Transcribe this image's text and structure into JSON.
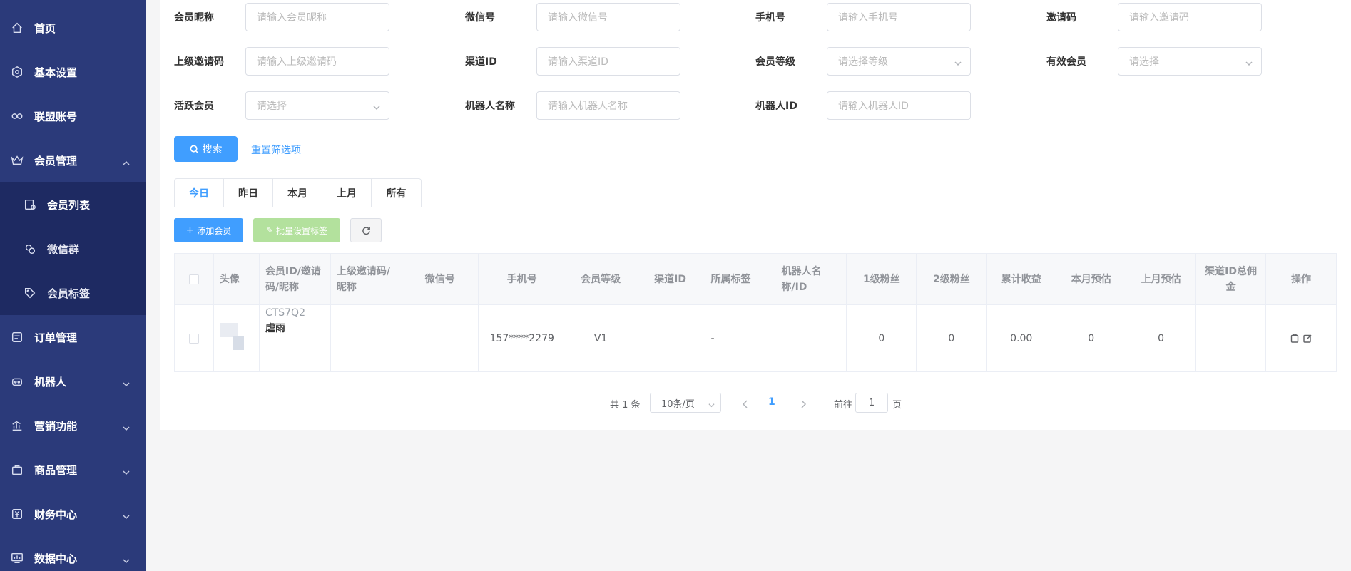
{
  "sidebar": {
    "items": [
      {
        "label": "首页",
        "icon": "home-icon"
      },
      {
        "label": "基本设置",
        "icon": "settings-icon"
      },
      {
        "label": "联盟账号",
        "icon": "link-icon"
      },
      {
        "label": "会员管理",
        "icon": "crown-icon",
        "expanded": true
      },
      {
        "label": "订单管理",
        "icon": "order-icon"
      },
      {
        "label": "机器人",
        "icon": "robot-icon"
      },
      {
        "label": "营销功能",
        "icon": "chart-icon"
      },
      {
        "label": "商品管理",
        "icon": "goods-icon"
      },
      {
        "label": "财务中心",
        "icon": "finance-icon"
      },
      {
        "label": "数据中心",
        "icon": "monitor-icon"
      }
    ],
    "sub_items": [
      {
        "label": "会员列表",
        "icon": "member-list-icon",
        "active": true
      },
      {
        "label": "微信群",
        "icon": "wechat-group-icon"
      },
      {
        "label": "会员标签",
        "icon": "tag-icon"
      }
    ]
  },
  "filters": [
    {
      "label": "会员昵称",
      "placeholder": "请输入会员昵称",
      "type": "input"
    },
    {
      "label": "微信号",
      "placeholder": "请输入微信号",
      "type": "input"
    },
    {
      "label": "手机号",
      "placeholder": "请输入手机号",
      "type": "input"
    },
    {
      "label": "邀请码",
      "placeholder": "请输入邀请码",
      "type": "input"
    },
    {
      "label": "上级邀请码",
      "placeholder": "请输入上级邀请码",
      "type": "input"
    },
    {
      "label": "渠道ID",
      "placeholder": "请输入渠道ID",
      "type": "input"
    },
    {
      "label": "会员等级",
      "placeholder": "请选择等级",
      "type": "select"
    },
    {
      "label": "有效会员",
      "placeholder": "请选择",
      "type": "select"
    },
    {
      "label": "活跃会员",
      "placeholder": "请选择",
      "type": "select"
    },
    {
      "label": "机器人名称",
      "placeholder": "请输入机器人名称",
      "type": "input"
    },
    {
      "label": "机器人ID",
      "placeholder": "请输入机器人ID",
      "type": "input"
    }
  ],
  "actions": {
    "search": "搜索",
    "reset": "重置筛选项",
    "add": "添加会员",
    "batch_tag": "批量设置标签"
  },
  "tabs": [
    {
      "label": "今日",
      "active": true
    },
    {
      "label": "昨日"
    },
    {
      "label": "本月"
    },
    {
      "label": "上月"
    },
    {
      "label": "所有"
    }
  ],
  "table": {
    "headers": [
      "头像",
      "会员ID/邀请码/昵称",
      "上级邀请码/昵称",
      "微信号",
      "手机号",
      "会员等级",
      "渠道ID",
      "所属标签",
      "机器人名称/ID",
      "1级粉丝",
      "2级粉丝",
      "累计收益",
      "本月预估",
      "上月预估",
      "渠道ID总佣金",
      "操作"
    ],
    "rows": [
      {
        "id_code": "CTS7Q2",
        "nickname": "虐雨",
        "parent": "",
        "wechat": "",
        "phone": "157****2279",
        "level": "V1",
        "channel": "",
        "tag": "-",
        "robot": "",
        "fans1": "0",
        "fans2": "0",
        "total": "0.00",
        "month_est": "0",
        "last_month_est": "0",
        "channel_commission": ""
      }
    ]
  },
  "pagination": {
    "total": "共 1 条",
    "page_size": "10条/页",
    "current": "1",
    "goto_label": "前往",
    "goto_value": "1",
    "unit": "页"
  },
  "colors": {
    "sidebar": "#2b3a7a",
    "sidebar_sub": "#1e2a62",
    "primary": "#409eff",
    "batch_disabled": "#b3e19d"
  }
}
